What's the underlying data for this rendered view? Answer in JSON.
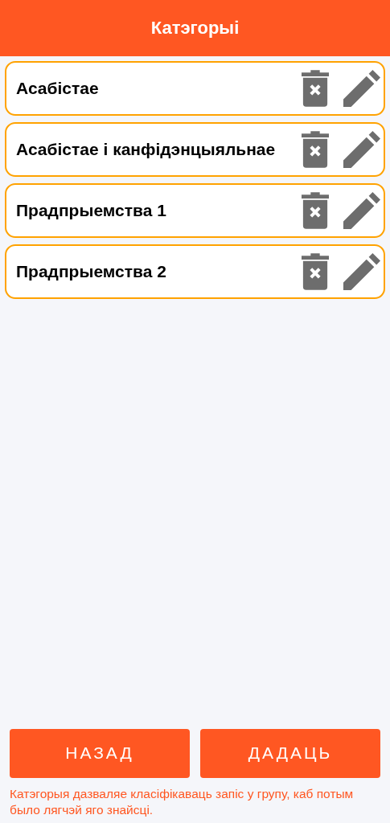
{
  "header": {
    "title": "Катэгорыі"
  },
  "categories": [
    {
      "name": "Асабістае"
    },
    {
      "name": "Асабістае і канфідэнцыяльнае"
    },
    {
      "name": "Прадпрыемства 1"
    },
    {
      "name": "Прадпрыемства 2"
    }
  ],
  "buttons": [
    {
      "label": "НАЗАД"
    },
    {
      "label": "ДАДАЦЬ"
    }
  ],
  "hint": "Катэгорыя дазваляе класіфікаваць запіс у групу, каб потым было лягчэй яго знайсці."
}
